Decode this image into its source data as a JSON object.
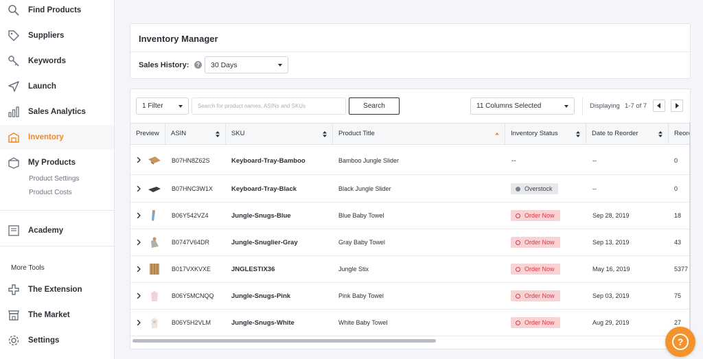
{
  "sidebar": {
    "items": [
      {
        "label": "Find Products",
        "icon": "search-icon"
      },
      {
        "label": "Suppliers",
        "icon": "tag-icon"
      },
      {
        "label": "Keywords",
        "icon": "key-icon"
      },
      {
        "label": "Launch",
        "icon": "send-icon"
      },
      {
        "label": "Sales Analytics",
        "icon": "bar-chart-icon"
      },
      {
        "label": "Inventory",
        "icon": "warehouse-icon",
        "active": true
      },
      {
        "label": "My Products",
        "icon": "box-icon"
      }
    ],
    "sub_items": [
      "Product Settings",
      "Product Costs"
    ],
    "academy": {
      "label": "Academy",
      "icon": "book-icon"
    },
    "more_tools_label": "More Tools",
    "tools": [
      {
        "label": "The Extension",
        "icon": "puzzle-icon"
      },
      {
        "label": "The Market",
        "icon": "store-icon"
      },
      {
        "label": "Settings",
        "icon": "gear-icon"
      }
    ],
    "active_color": "#f08a24"
  },
  "header": {
    "title": "Inventory Manager",
    "sales_history_label": "Sales History:",
    "help_icon": "?",
    "sales_history_value": "30 Days"
  },
  "toolbar": {
    "filter_label": "1 Filter",
    "search_placeholder": "Search for product names, ASINs and SKUs",
    "search_button": "Search",
    "columns_label": "11 Columns Selected",
    "displaying_label": "Displaying",
    "displaying_range": "1-7  of 7"
  },
  "table": {
    "columns": [
      "Preview",
      "ASIN",
      "SKU",
      "Product Title",
      "Inventory Status",
      "Date to Reorder",
      "Reord"
    ],
    "rows": [
      {
        "asin": "B07HN8Z62S",
        "sku": "Keyboard-Tray-Bamboo",
        "title": "Bamboo Jungle Slider",
        "status": "--",
        "date": "--",
        "reorder": "0"
      },
      {
        "asin": "B07HNC3W1X",
        "sku": "Keyboard-Tray-Black",
        "title": "Black Jungle Slider",
        "status": "Overstock",
        "date": "--",
        "reorder": "0"
      },
      {
        "asin": "B06Y542VZ4",
        "sku": "Jungle-Snugs-Blue",
        "title": "Blue Baby Towel",
        "status": "Order Now",
        "date": "Sep 28, 2019",
        "reorder": "18"
      },
      {
        "asin": "B0747V64DR",
        "sku": "Jungle-Snuglier-Gray",
        "title": "Gray Baby Towel",
        "status": "Order Now",
        "date": "Sep 13, 2019",
        "reorder": "43"
      },
      {
        "asin": "B017VXKVXE",
        "sku": "JNGLESTIX36",
        "title": "Jungle Stix",
        "status": "Order Now",
        "date": "May 16, 2019",
        "reorder": "5377"
      },
      {
        "asin": "B06Y5MCNQQ",
        "sku": "Jungle-Snugs-Pink",
        "title": "Pink Baby Towel",
        "status": "Order Now",
        "date": "Sep 03, 2019",
        "reorder": "75"
      },
      {
        "asin": "B06Y5H2VLM",
        "sku": "Jungle-Snugs-White",
        "title": "White Baby Towel",
        "status": "Order Now",
        "date": "Aug 29, 2019",
        "reorder": "27"
      }
    ]
  },
  "colors": {
    "accent": "#f4922b",
    "order_now_bg": "#f8d2d4",
    "order_now_text": "#d7393f",
    "overstock_bg": "#e6e8eb"
  },
  "help_fab": "?"
}
